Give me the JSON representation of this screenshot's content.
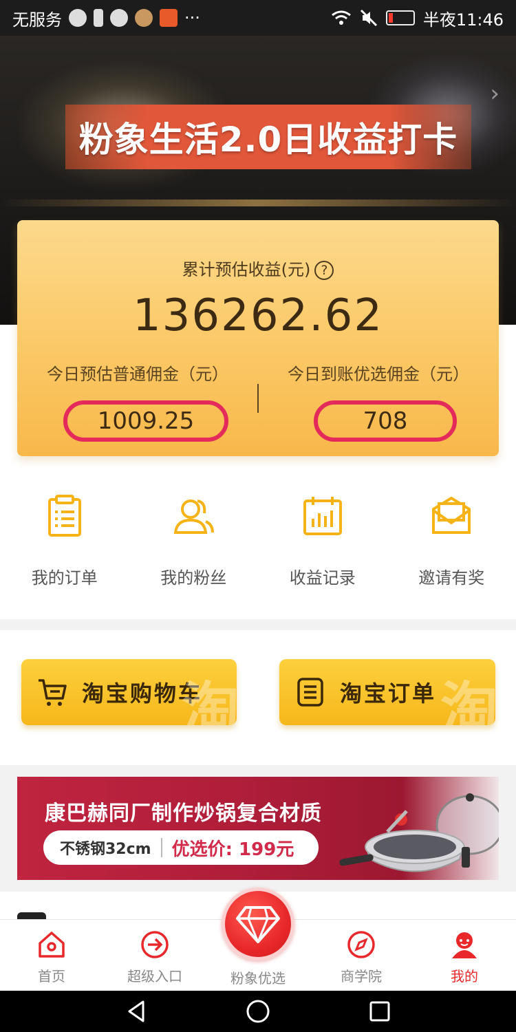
{
  "status_bar": {
    "carrier": "无服务",
    "time": "半夜11:46",
    "more": "···"
  },
  "hero": {
    "banner_text": "粉象生活2.0日收益打卡",
    "chevron": "›"
  },
  "earnings": {
    "cumulative_label": "累计预估收益(元)",
    "help": "?",
    "cumulative_value": "136262.62",
    "today_normal_label": "今日预估普通佣金（元）",
    "today_normal_value": "1009.25",
    "today_selected_label": "今日到账优选佣金（元）",
    "today_selected_value": "708"
  },
  "quick_links": [
    {
      "label": "我的订单",
      "icon": "clipboard-icon"
    },
    {
      "label": "我的粉丝",
      "icon": "fans-icon"
    },
    {
      "label": "收益记录",
      "icon": "calendar-chart-icon"
    },
    {
      "label": "邀请有奖",
      "icon": "envelope-icon"
    }
  ],
  "taobao": {
    "cart_label": "淘宝购物车",
    "order_label": "淘宝订单",
    "watermark": "淘"
  },
  "promo": {
    "title": "康巴赫同厂制作炒锅复合材质",
    "spec": "不锈钢32cm",
    "price": "优选价: 199元"
  },
  "bottom_nav": [
    {
      "label": "首页",
      "icon": "home-icon"
    },
    {
      "label": "超级入口",
      "icon": "enter-icon"
    },
    {
      "label": "粉象优选",
      "icon": "diamond-icon"
    },
    {
      "label": "商学院",
      "icon": "compass-icon"
    },
    {
      "label": "我的",
      "icon": "profile-icon",
      "active": true
    }
  ],
  "colors": {
    "accent": "#e8282a",
    "gold": "#fbc866",
    "highlight_ring": "#e32a5a"
  }
}
